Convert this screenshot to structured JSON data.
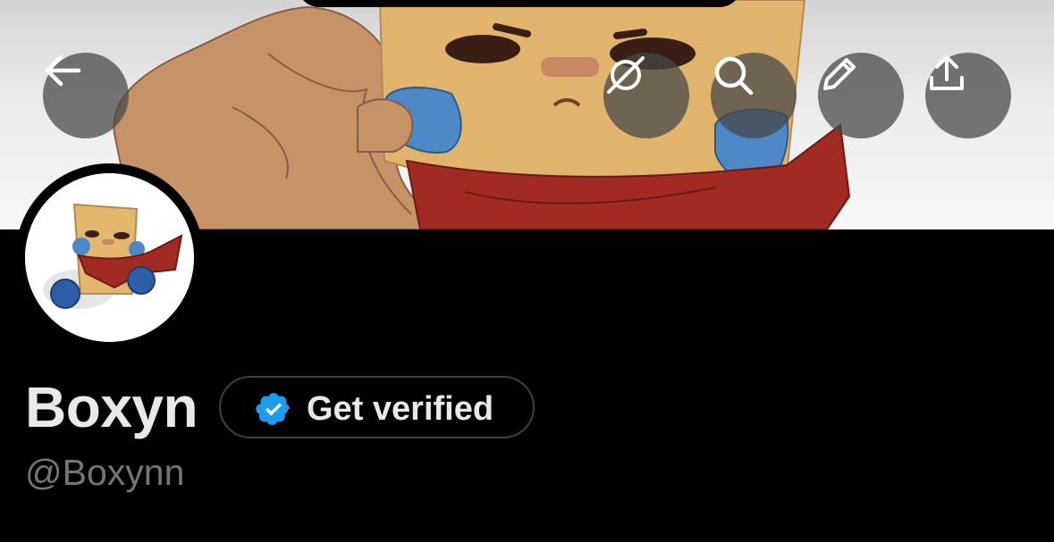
{
  "profile": {
    "display_name": "Boxyn",
    "handle": "@Boxynn"
  },
  "verify": {
    "label": "Get verified"
  },
  "toolbar": {
    "back_icon": "arrow-left-icon",
    "grok_icon": "grok-icon",
    "search_icon": "search-icon",
    "edit_icon": "pencil-icon",
    "share_icon": "share-icon"
  },
  "colors": {
    "background": "#000000",
    "primary_text": "#e7e9ea",
    "secondary_text": "#71767b",
    "verify_badge": "#1d9bf0",
    "button_border": "#3e4144"
  }
}
